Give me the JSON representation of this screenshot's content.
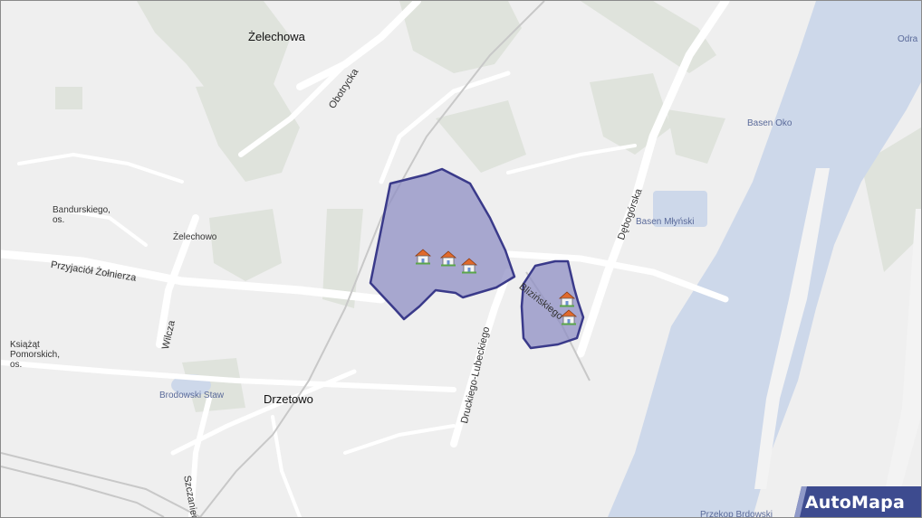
{
  "places": {
    "zelechowa": "Żelechowa",
    "drzetowo": "Drzetowo",
    "bandurskiego": "Bandurskiego,",
    "bandurskiego_suffix": "os.",
    "zelechowo": "Żelechowo",
    "ksiazat": "Książąt",
    "ksiazat_2": "Pomorskich,",
    "ksiazat_suffix": "os."
  },
  "water": {
    "odra": "Odra",
    "basen_oko": "Basen Oko",
    "basen_mlynski": "Basen Młyński",
    "brodowski_staw": "Brodowski Staw",
    "przekop_brdowski": "Przekop Brdowski"
  },
  "streets": {
    "obotrycka": "Obotrycka",
    "przyjaciol_zolnierza": "Przyjaciół Żołnierza",
    "wilcza": "Wilcza",
    "druckiego_lubeckiego": "Druckiego-Lubeckiego",
    "debogorska": "Dębogórska",
    "blizinskiego": "Blizińskiego",
    "szczaniec": "Szczaniec"
  },
  "markers": [
    {
      "icon": "house-icon"
    },
    {
      "icon": "house-icon"
    },
    {
      "icon": "house-icon"
    },
    {
      "icon": "house-icon"
    },
    {
      "icon": "house-icon"
    }
  ],
  "colors": {
    "area_fill": "#8f8fc4",
    "area_stroke": "#3a3a8a",
    "water": "#cdd8ea",
    "greenery": "#dfe3dc",
    "brand": "#3d4b8f"
  },
  "brand": {
    "logo": "AutoMapa"
  }
}
